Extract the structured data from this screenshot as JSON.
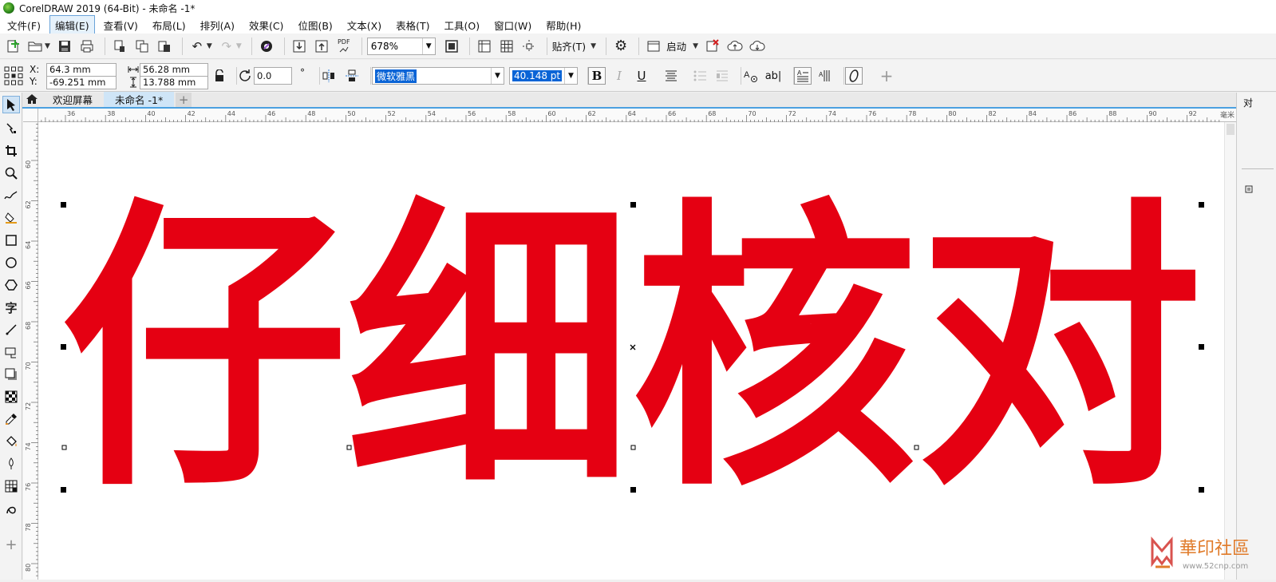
{
  "window": {
    "title": "CorelDRAW 2019 (64-Bit) - 未命名 -1*"
  },
  "menu": [
    {
      "label": "文件(F)"
    },
    {
      "label": "编辑(E)",
      "active": true
    },
    {
      "label": "查看(V)"
    },
    {
      "label": "布局(L)"
    },
    {
      "label": "排列(A)"
    },
    {
      "label": "效果(C)"
    },
    {
      "label": "位图(B)"
    },
    {
      "label": "文本(X)"
    },
    {
      "label": "表格(T)"
    },
    {
      "label": "工具(O)"
    },
    {
      "label": "窗口(W)"
    },
    {
      "label": "帮助(H)"
    }
  ],
  "toolbar": {
    "zoom_value": "678%",
    "snap_label": "贴齐(T)",
    "launch_label": "启动",
    "pdf_label": "PDF"
  },
  "property_bar": {
    "x_label": "X:",
    "y_label": "Y:",
    "x_value": "64.3 mm",
    "y_value": "-69.251 mm",
    "width_value": "56.28 mm",
    "height_value": "13.788 mm",
    "angle_value": "0.0",
    "degree_symbol": "°",
    "font_name": "微软雅黑",
    "font_size": "40.148 pt",
    "bold_label": "B",
    "italic_label": "I",
    "underline_label": "U",
    "char_label": "ab"
  },
  "tabs": {
    "welcome": "欢迎屏幕",
    "document": "未命名 -1*"
  },
  "ruler": {
    "unit": "毫米",
    "h_ticks": [
      "36",
      "38",
      "40",
      "42",
      "44",
      "46",
      "48",
      "50",
      "52",
      "54",
      "56",
      "58",
      "60",
      "62",
      "64",
      "66",
      "68",
      "70",
      "72",
      "74",
      "76",
      "78",
      "80",
      "82",
      "84",
      "86",
      "88",
      "90",
      "92"
    ],
    "v_ticks": [
      "60",
      "62",
      "64",
      "66",
      "68",
      "70",
      "72",
      "74",
      "76",
      "78",
      "80"
    ]
  },
  "canvas": {
    "text": "仔细核对",
    "text_color": "#e50012"
  },
  "side_panel": {
    "label": "对"
  },
  "watermark": {
    "text": "華印社區",
    "url": "www.52cnp.com"
  }
}
